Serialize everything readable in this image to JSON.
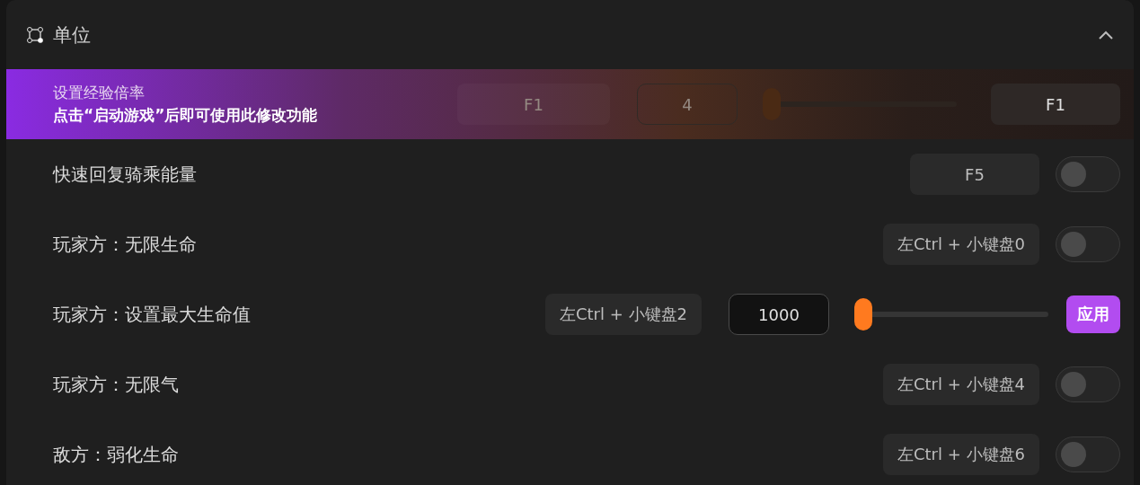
{
  "section": {
    "title": "单位",
    "expanded": true
  },
  "locked_row": {
    "title": "设置经验倍率",
    "notice": "点击“启动游戏”后即可使用此修改功能",
    "hotkey": "F1",
    "value": "4",
    "level": 0,
    "key": "F1"
  },
  "rows": [
    {
      "kind": "toggle",
      "label": "快速回复骑乘能量",
      "hotkey": "F5",
      "on": false
    },
    {
      "kind": "toggle",
      "label": "玩家方：无限生命",
      "hotkey": "左Ctrl + 小键盘0",
      "on": false
    },
    {
      "kind": "slider",
      "label": "玩家方：设置最大生命值",
      "hotkey": "左Ctrl + 小键盘2",
      "value": "1000",
      "level": 0,
      "button": "应用"
    },
    {
      "kind": "toggle",
      "label": "玩家方：无限气",
      "hotkey": "左Ctrl + 小键盘4",
      "on": false
    },
    {
      "kind": "toggle",
      "label": "敌方：弱化生命",
      "hotkey": "左Ctrl + 小键盘6",
      "on": false
    }
  ]
}
